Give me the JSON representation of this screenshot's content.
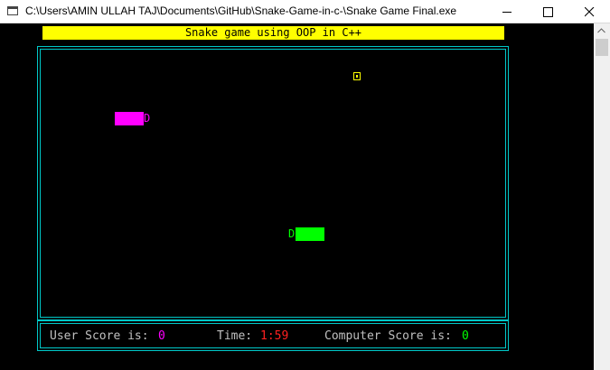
{
  "window": {
    "title": "C:\\Users\\AMIN ULLAH TAJ\\Documents\\GitHub\\Snake-Game-in-c-\\Snake Game Final.exe",
    "icon": "console-app-icon",
    "buttons": [
      "minimize",
      "maximize",
      "close"
    ]
  },
  "game": {
    "banner": "Snake game using OOP in C++",
    "user_snake": {
      "head_char": "D",
      "color": "#ff00ff"
    },
    "computer_snake": {
      "head_char": "D",
      "color": "#00ff00"
    },
    "food": {
      "icon": "food-box-icon",
      "color": "#ffff00"
    }
  },
  "scoreboard": {
    "user_label": "User Score is:",
    "user_score": "0",
    "time_label": "Time:",
    "time_value": "1:59",
    "computer_label": "Computer Score is:",
    "computer_score": "0"
  },
  "colors": {
    "border": "#00c8c8",
    "banner_bg": "#ffff00",
    "time": "#ff2020"
  }
}
